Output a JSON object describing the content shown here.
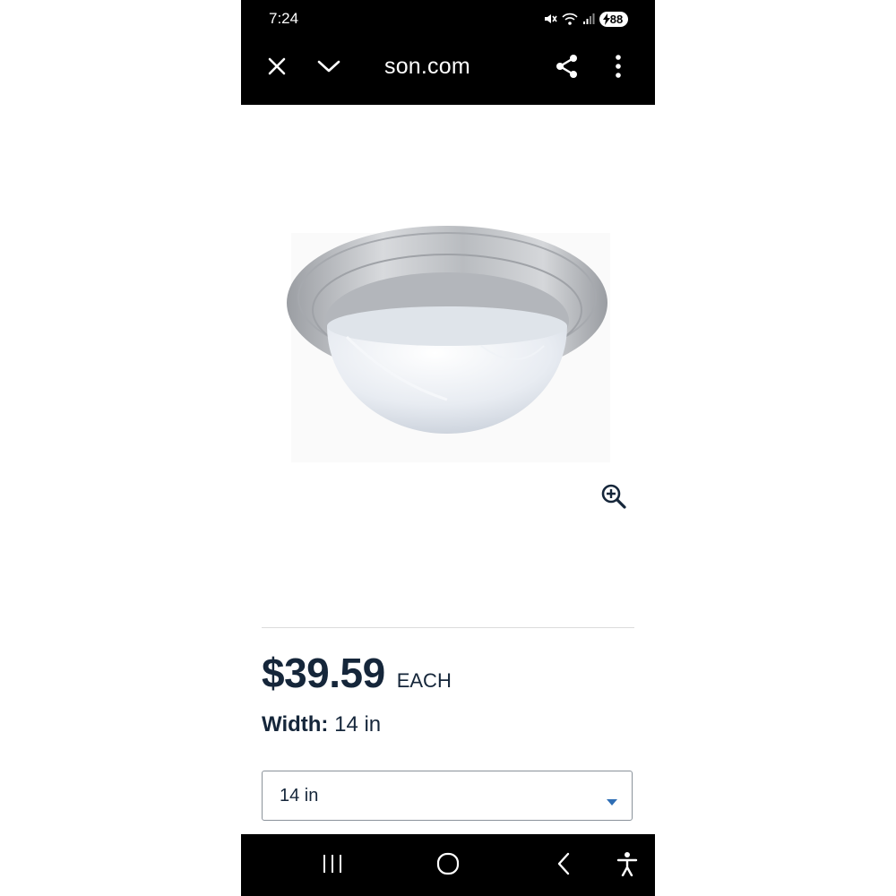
{
  "status_bar": {
    "time": "7:24",
    "battery": "88"
  },
  "browser": {
    "url": "son.com",
    "close_icon": "close-icon",
    "collapse_icon": "chevron-down-icon",
    "share_icon": "share-icon",
    "menu_icon": "more-vert-icon"
  },
  "product": {
    "image_alt": "flush mount ceiling light",
    "price": "$39.59",
    "price_unit": "EACH",
    "width_label": "Width:",
    "width_value": "14 in",
    "size_select": {
      "selected": "14 in"
    }
  },
  "nav_bar": {
    "recents_icon": "recents-icon",
    "home_icon": "home-icon",
    "back_icon": "back-icon",
    "accessibility_icon": "accessibility-icon"
  },
  "colors": {
    "text_primary": "#15263a",
    "accent_caret": "#2f6eb5",
    "bar_background": "#000000"
  }
}
